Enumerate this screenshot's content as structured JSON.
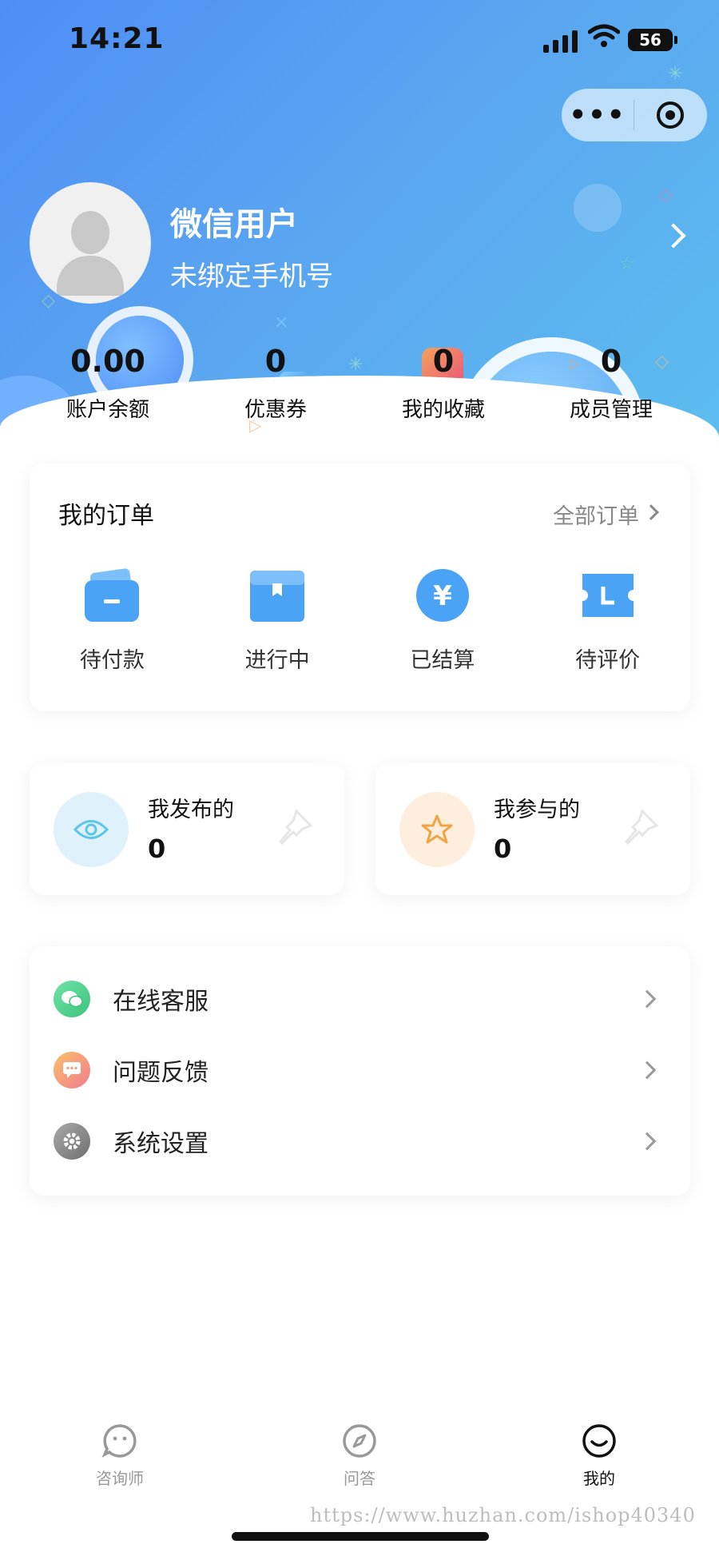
{
  "status_bar": {
    "time": "14:21",
    "battery": "56"
  },
  "capsule": {
    "more_icon": "more-dots-icon",
    "close_icon": "target-icon"
  },
  "profile": {
    "name": "微信用户",
    "phone": "未绑定手机号"
  },
  "stats": [
    {
      "value": "0.00",
      "label": "账户余额"
    },
    {
      "value": "0",
      "label": "优惠券"
    },
    {
      "value": "0",
      "label": "我的收藏"
    },
    {
      "value": "0",
      "label": "成员管理"
    }
  ],
  "orders": {
    "title": "我的订单",
    "all_label": "全部订单",
    "items": [
      {
        "label": "待付款",
        "icon": "wallet-icon"
      },
      {
        "label": "进行中",
        "icon": "box-icon"
      },
      {
        "label": "已结算",
        "icon": "yen-icon"
      },
      {
        "label": "待评价",
        "icon": "ticket-icon"
      }
    ]
  },
  "published": {
    "title": "我发布的",
    "count": "0"
  },
  "joined": {
    "title": "我参与的",
    "count": "0"
  },
  "menu": [
    {
      "label": "在线客服",
      "icon": "wechat-icon",
      "color": "#4cd38a"
    },
    {
      "label": "问题反馈",
      "icon": "message-icon",
      "color": "#f7a86a"
    },
    {
      "label": "系统设置",
      "icon": "settings-icon",
      "color": "#8a8a8a"
    }
  ],
  "tabbar": [
    {
      "label": "咨询师",
      "icon": "smile-bubble-icon",
      "active": false
    },
    {
      "label": "问答",
      "icon": "compass-icon",
      "active": false
    },
    {
      "label": "我的",
      "icon": "smile-icon",
      "active": true
    }
  ],
  "watermark": "https://www.huzhan.com/ishop40340",
  "colors": {
    "accent": "#4f8ef5",
    "header_end": "#5cc0ef"
  }
}
